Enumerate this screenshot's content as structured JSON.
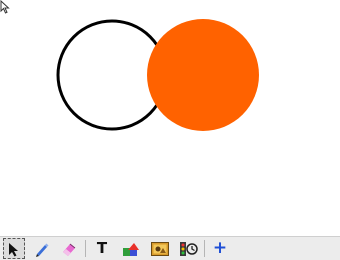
{
  "canvas": {
    "shapes": [
      {
        "kind": "circle",
        "name": "outline-circle",
        "fill": "#ffffff",
        "stroke": "#000000"
      },
      {
        "kind": "circle",
        "name": "filled-circle",
        "fill": "#ff6200",
        "stroke": "none"
      }
    ],
    "cursor_icon": "mouse-pointer-icon"
  },
  "toolbar": {
    "tools": [
      {
        "id": "select",
        "icon": "select-arrow-icon",
        "selected": true
      },
      {
        "id": "pen",
        "icon": "pen-icon",
        "selected": false
      },
      {
        "id": "eraser",
        "icon": "eraser-icon",
        "selected": false
      },
      {
        "id": "text",
        "icon": "text-tool-icon",
        "label": "T",
        "selected": false
      },
      {
        "id": "shapes",
        "icon": "shapes-icon",
        "selected": false
      },
      {
        "id": "image",
        "icon": "image-icon",
        "selected": false
      },
      {
        "id": "media",
        "icon": "media-icon",
        "selected": false
      },
      {
        "id": "add",
        "icon": "plus-icon",
        "label": "+",
        "selected": false
      }
    ],
    "colors": {
      "accent": "#1f4fd6",
      "bar": "#ececec"
    }
  }
}
